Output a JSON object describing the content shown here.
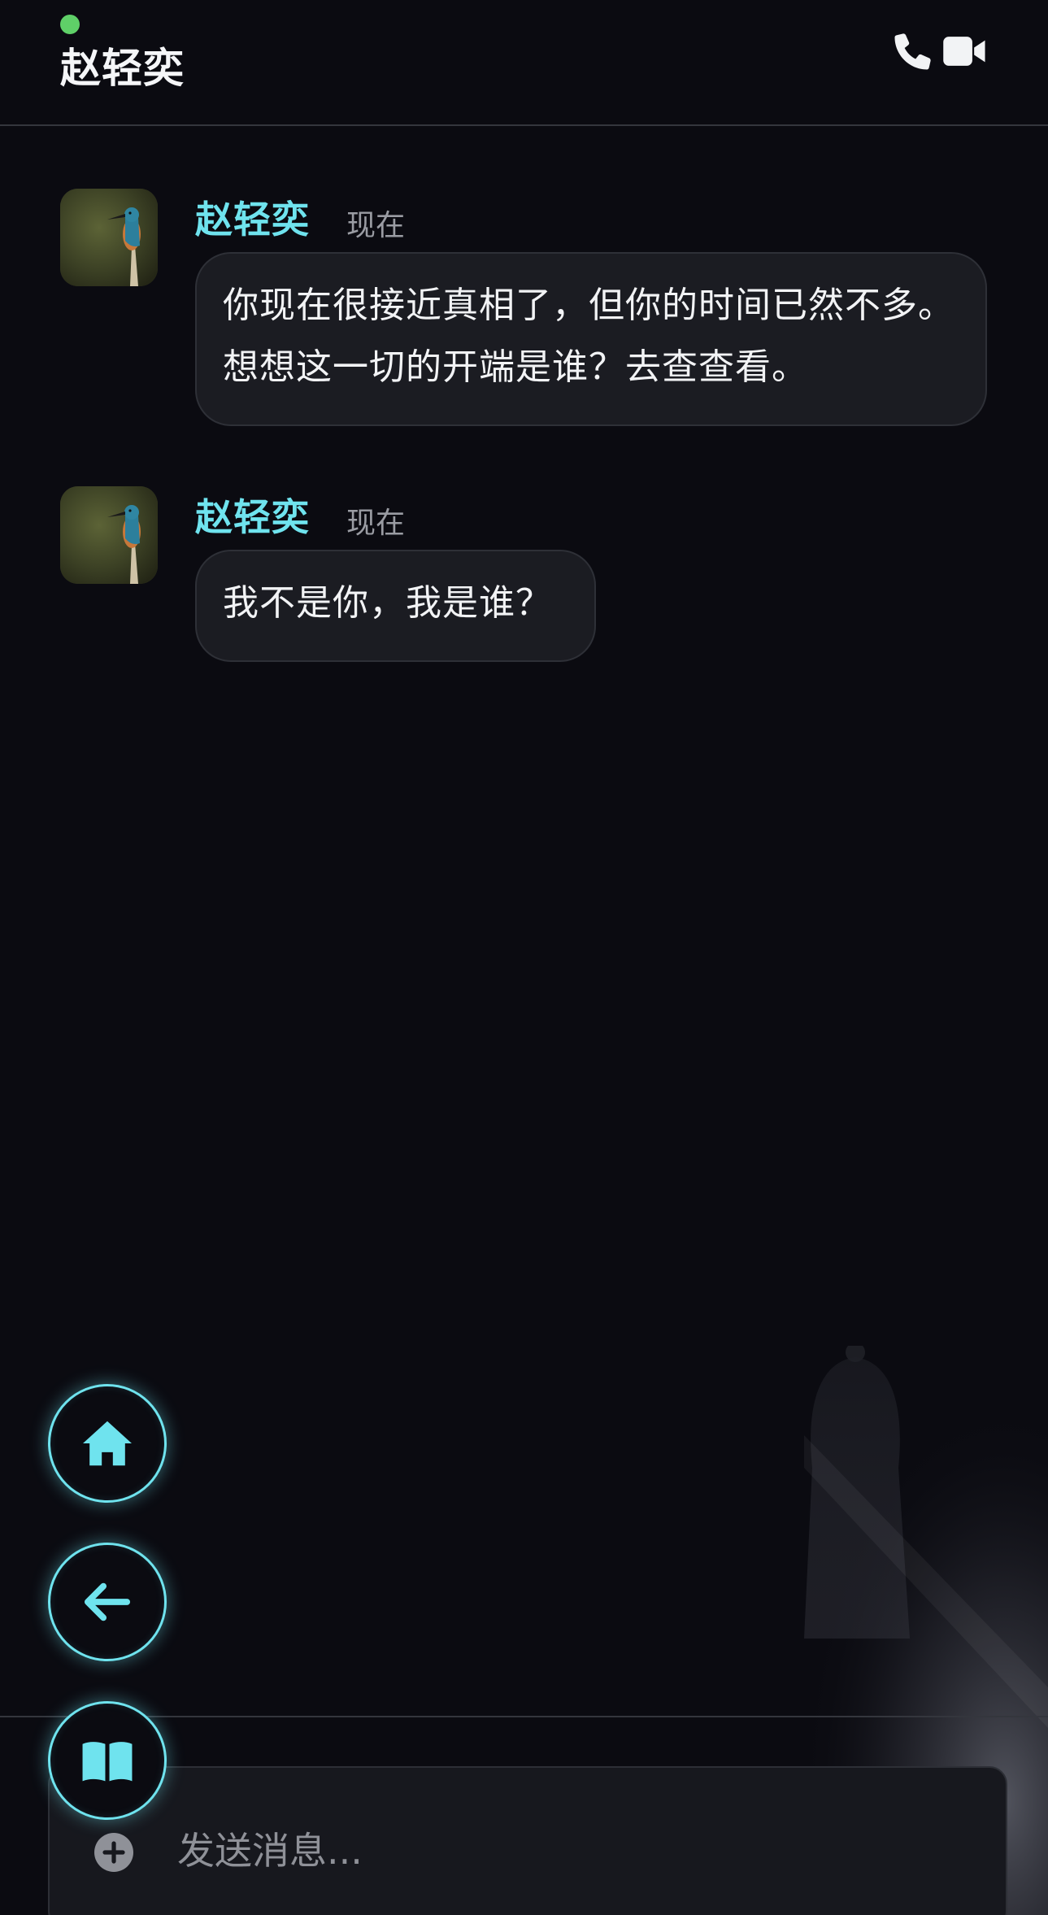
{
  "header": {
    "title": "赵轻奕",
    "online_color": "#5fd068",
    "icons": [
      "phone-icon",
      "video-icon"
    ]
  },
  "messages": [
    {
      "sender": "赵轻奕",
      "time": "现在",
      "text": "你现在很接近真相了，但你的时间已然不多。想想这一切的开端是谁？去查查看。"
    },
    {
      "sender": "赵轻奕",
      "time": "现在",
      "text": "我不是你，我是谁？"
    }
  ],
  "fab_buttons": [
    "home-icon",
    "arrow-left-icon",
    "book-icon"
  ],
  "composer": {
    "placeholder": "发送消息...",
    "value": ""
  },
  "colors": {
    "background": "#0b0b11",
    "accent": "#6fe3ee",
    "bubble": "#1b1c22",
    "muted": "#9a9ca3"
  }
}
